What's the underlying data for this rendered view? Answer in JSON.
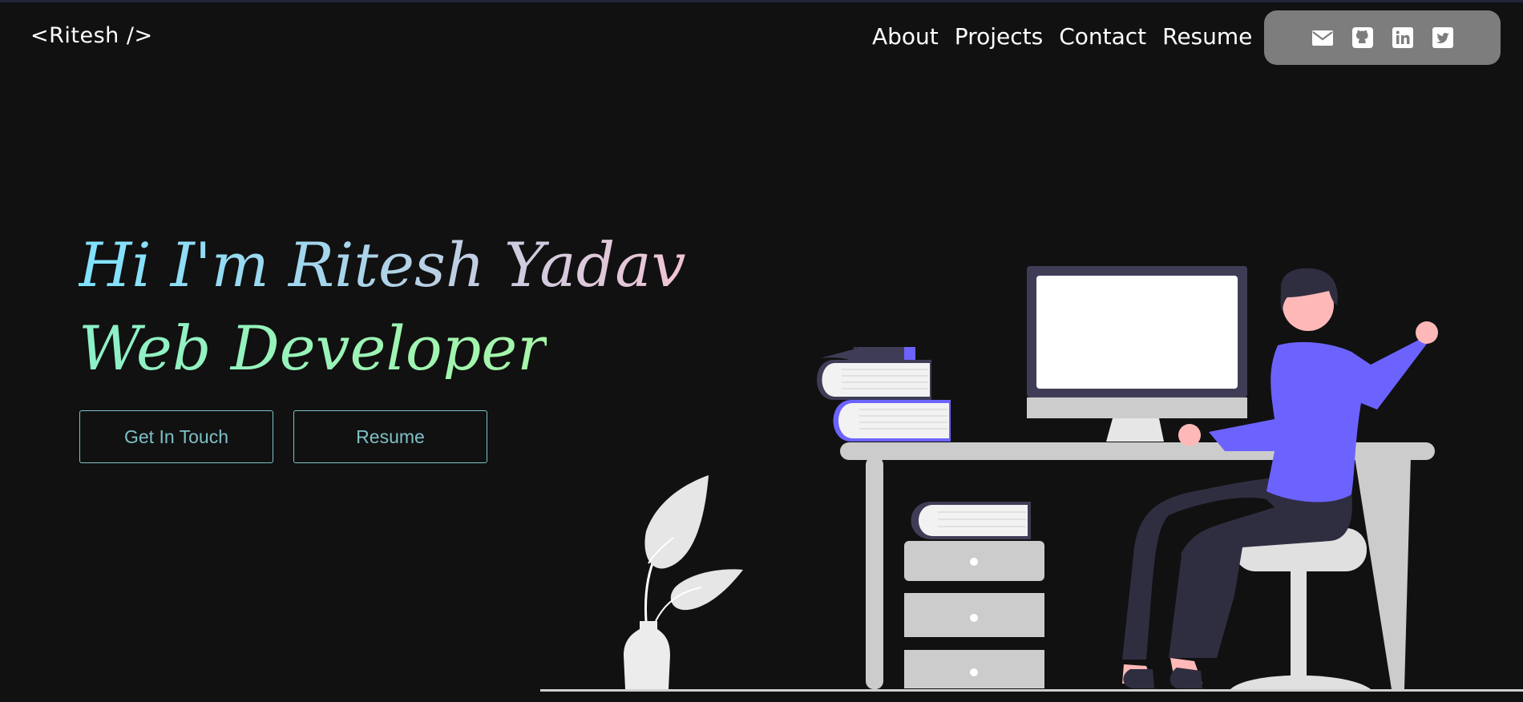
{
  "header": {
    "logo": "<Ritesh />",
    "nav": [
      "About",
      "Projects",
      "Contact",
      "Resume"
    ]
  },
  "social": {
    "icons": [
      "envelope-icon",
      "github-icon",
      "linkedin-icon",
      "twitter-icon"
    ]
  },
  "hero": {
    "line1": "Hi I'm Ritesh Yadav",
    "line2": "Web Developer",
    "cta_primary": "Get In Touch",
    "cta_secondary": "Resume"
  },
  "colors": {
    "background": "#111111",
    "accent_purple": "#6c63ff",
    "button_border": "#7fc3c8",
    "social_bar": "#7d7d7d"
  }
}
